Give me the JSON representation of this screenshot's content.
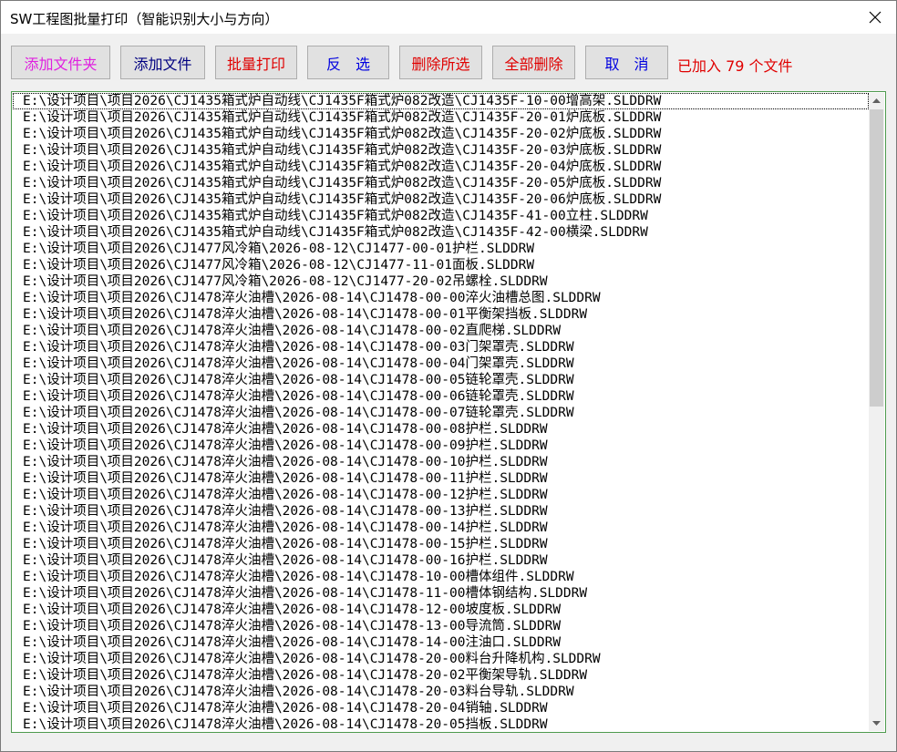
{
  "window": {
    "title": "SW工程图批量打印（智能识别大小与方向）"
  },
  "toolbar": {
    "add_folder": "添加文件夹",
    "add_file": "添加文件",
    "batch_print": "批量打印",
    "invert_select": "反　选",
    "delete_selected": "删除所选",
    "delete_all": "全部删除",
    "cancel": "取　消",
    "count_label": "已加入  79  个文件"
  },
  "colors": {
    "add_folder": "#e020e0",
    "add_file": "#000080",
    "batch_print": "#e00000",
    "invert_select": "#0000e0",
    "delete_selected": "#e00000",
    "delete_all": "#e00000",
    "cancel": "#0000e0",
    "count_label": "#e00000"
  },
  "files": [
    "E:\\设计项目\\项目2026\\CJ1435箱式炉自动线\\CJ1435F箱式炉082改造\\CJ1435F-10-00增高架.SLDDRW",
    "E:\\设计项目\\项目2026\\CJ1435箱式炉自动线\\CJ1435F箱式炉082改造\\CJ1435F-20-01炉底板.SLDDRW",
    "E:\\设计项目\\项目2026\\CJ1435箱式炉自动线\\CJ1435F箱式炉082改造\\CJ1435F-20-02炉底板.SLDDRW",
    "E:\\设计项目\\项目2026\\CJ1435箱式炉自动线\\CJ1435F箱式炉082改造\\CJ1435F-20-03炉底板.SLDDRW",
    "E:\\设计项目\\项目2026\\CJ1435箱式炉自动线\\CJ1435F箱式炉082改造\\CJ1435F-20-04炉底板.SLDDRW",
    "E:\\设计项目\\项目2026\\CJ1435箱式炉自动线\\CJ1435F箱式炉082改造\\CJ1435F-20-05炉底板.SLDDRW",
    "E:\\设计项目\\项目2026\\CJ1435箱式炉自动线\\CJ1435F箱式炉082改造\\CJ1435F-20-06炉底板.SLDDRW",
    "E:\\设计项目\\项目2026\\CJ1435箱式炉自动线\\CJ1435F箱式炉082改造\\CJ1435F-41-00立柱.SLDDRW",
    "E:\\设计项目\\项目2026\\CJ1435箱式炉自动线\\CJ1435F箱式炉082改造\\CJ1435F-42-00横梁.SLDDRW",
    "E:\\设计项目\\项目2026\\CJ1477风冷箱\\2026-08-12\\CJ1477-00-01护栏.SLDDRW",
    "E:\\设计项目\\项目2026\\CJ1477风冷箱\\2026-08-12\\CJ1477-11-01面板.SLDDRW",
    "E:\\设计项目\\项目2026\\CJ1477风冷箱\\2026-08-12\\CJ1477-20-02吊螺栓.SLDDRW",
    "E:\\设计项目\\项目2026\\CJ1478淬火油槽\\2026-08-14\\CJ1478-00-00淬火油槽总图.SLDDRW",
    "E:\\设计项目\\项目2026\\CJ1478淬火油槽\\2026-08-14\\CJ1478-00-01平衡架挡板.SLDDRW",
    "E:\\设计项目\\项目2026\\CJ1478淬火油槽\\2026-08-14\\CJ1478-00-02直爬梯.SLDDRW",
    "E:\\设计项目\\项目2026\\CJ1478淬火油槽\\2026-08-14\\CJ1478-00-03门架罩壳.SLDDRW",
    "E:\\设计项目\\项目2026\\CJ1478淬火油槽\\2026-08-14\\CJ1478-00-04门架罩壳.SLDDRW",
    "E:\\设计项目\\项目2026\\CJ1478淬火油槽\\2026-08-14\\CJ1478-00-05链轮罩壳.SLDDRW",
    "E:\\设计项目\\项目2026\\CJ1478淬火油槽\\2026-08-14\\CJ1478-00-06链轮罩壳.SLDDRW",
    "E:\\设计项目\\项目2026\\CJ1478淬火油槽\\2026-08-14\\CJ1478-00-07链轮罩壳.SLDDRW",
    "E:\\设计项目\\项目2026\\CJ1478淬火油槽\\2026-08-14\\CJ1478-00-08护栏.SLDDRW",
    "E:\\设计项目\\项目2026\\CJ1478淬火油槽\\2026-08-14\\CJ1478-00-09护栏.SLDDRW",
    "E:\\设计项目\\项目2026\\CJ1478淬火油槽\\2026-08-14\\CJ1478-00-10护栏.SLDDRW",
    "E:\\设计项目\\项目2026\\CJ1478淬火油槽\\2026-08-14\\CJ1478-00-11护栏.SLDDRW",
    "E:\\设计项目\\项目2026\\CJ1478淬火油槽\\2026-08-14\\CJ1478-00-12护栏.SLDDRW",
    "E:\\设计项目\\项目2026\\CJ1478淬火油槽\\2026-08-14\\CJ1478-00-13护栏.SLDDRW",
    "E:\\设计项目\\项目2026\\CJ1478淬火油槽\\2026-08-14\\CJ1478-00-14护栏.SLDDRW",
    "E:\\设计项目\\项目2026\\CJ1478淬火油槽\\2026-08-14\\CJ1478-00-15护栏.SLDDRW",
    "E:\\设计项目\\项目2026\\CJ1478淬火油槽\\2026-08-14\\CJ1478-00-16护栏.SLDDRW",
    "E:\\设计项目\\项目2026\\CJ1478淬火油槽\\2026-08-14\\CJ1478-10-00槽体组件.SLDDRW",
    "E:\\设计项目\\项目2026\\CJ1478淬火油槽\\2026-08-14\\CJ1478-11-00槽体钢结构.SLDDRW",
    "E:\\设计项目\\项目2026\\CJ1478淬火油槽\\2026-08-14\\CJ1478-12-00坡度板.SLDDRW",
    "E:\\设计项目\\项目2026\\CJ1478淬火油槽\\2026-08-14\\CJ1478-13-00导流筒.SLDDRW",
    "E:\\设计项目\\项目2026\\CJ1478淬火油槽\\2026-08-14\\CJ1478-14-00注油口.SLDDRW",
    "E:\\设计项目\\项目2026\\CJ1478淬火油槽\\2026-08-14\\CJ1478-20-00料台升降机构.SLDDRW",
    "E:\\设计项目\\项目2026\\CJ1478淬火油槽\\2026-08-14\\CJ1478-20-02平衡架导轨.SLDDRW",
    "E:\\设计项目\\项目2026\\CJ1478淬火油槽\\2026-08-14\\CJ1478-20-03料台导轨.SLDDRW",
    "E:\\设计项目\\项目2026\\CJ1478淬火油槽\\2026-08-14\\CJ1478-20-04销轴.SLDDRW",
    "E:\\设计项目\\项目2026\\CJ1478淬火油槽\\2026-08-14\\CJ1478-20-05挡板.SLDDRW"
  ],
  "scrollbar": {
    "up_icon": "chevron-up-icon",
    "down_icon": "chevron-down-icon"
  }
}
